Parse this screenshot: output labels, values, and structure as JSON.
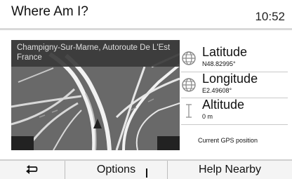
{
  "header": {
    "title": "Where Am I?",
    "time": "10:52"
  },
  "map": {
    "address_line1": "Champigny-Sur-Marne, Autoroute De L'Est",
    "address_line2": "France"
  },
  "location": {
    "latitude_label": "Latitude",
    "latitude_value": "N48.82995°",
    "longitude_label": "Longitude",
    "longitude_value": "E2.49608°",
    "altitude_label": "Altitude",
    "altitude_value": "0 m",
    "gps_note": "Current GPS position"
  },
  "toolbar": {
    "options_label": "Options",
    "help_nearby_label": "Help Nearby"
  },
  "icons": {
    "back": "back-arrow-icon",
    "globe": "globe-icon",
    "altitude": "altitude-icon"
  }
}
